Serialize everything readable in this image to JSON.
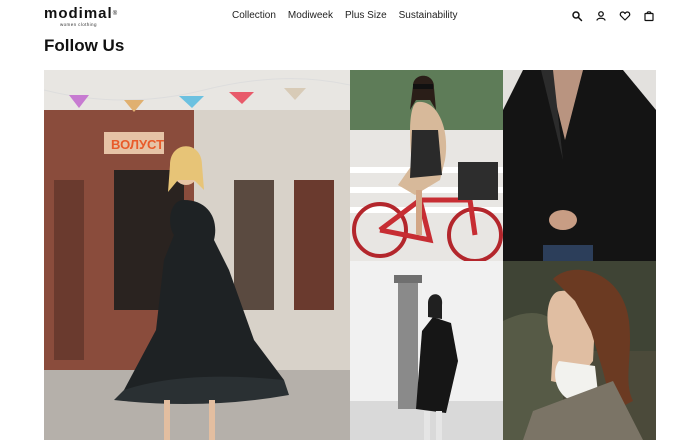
{
  "brand": {
    "name": "modimal",
    "mark": "®",
    "tagline": "women clothing"
  },
  "nav": {
    "items": [
      {
        "label": "Collection"
      },
      {
        "label": "Modiweek"
      },
      {
        "label": "Plus Size"
      },
      {
        "label": "Sustainability"
      }
    ]
  },
  "header_icons": [
    "search-icon",
    "user-icon",
    "heart-icon",
    "bag-icon"
  ],
  "section": {
    "title": "Follow Us"
  },
  "gallery": {
    "storefront_sign": "ВОЛУСТ",
    "photos": [
      "photo-woman-pleated-dress-street",
      "photo-woman-riding-bicycle",
      "photo-woman-black-blazer",
      "photo-woman-black-coat-monochrome",
      "photo-woman-long-hair"
    ]
  },
  "colors": {
    "text": "#111111",
    "background": "#ffffff"
  }
}
